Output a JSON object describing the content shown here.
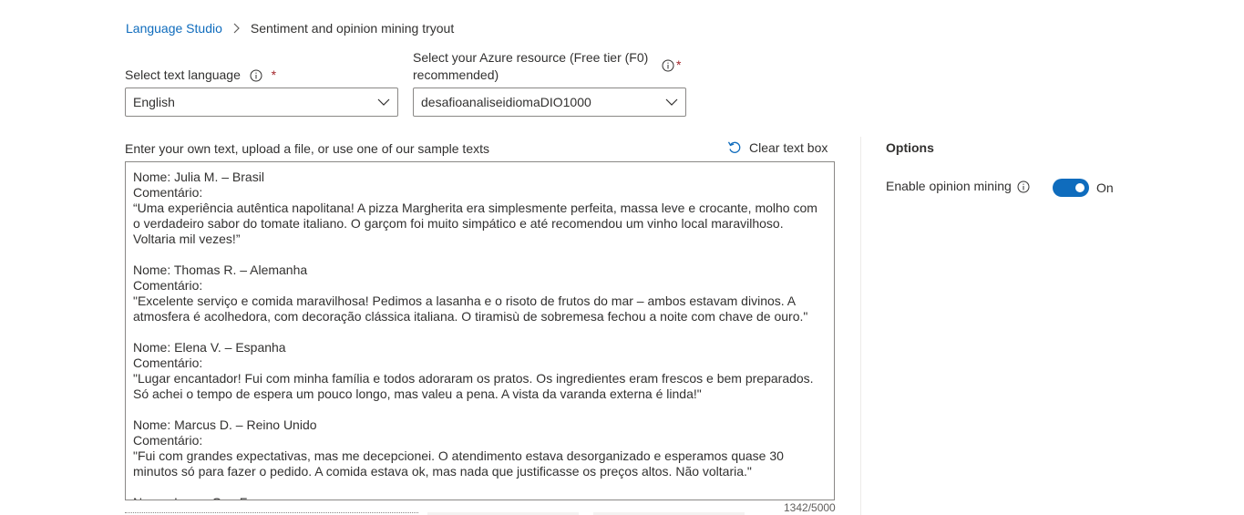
{
  "breadcrumb": {
    "home": "Language Studio",
    "current": "Sentiment and opinion mining tryout"
  },
  "language": {
    "label": "Select text language",
    "required_mark": "*",
    "value": "English"
  },
  "resource": {
    "label_line1": "Select your Azure resource (Free tier (F0)",
    "label_line2": "recommended)",
    "required_mark": "*",
    "value": "desafioanaliseidiomaDIO1000"
  },
  "input": {
    "instructions": "Enter your own text, upload a file, or use one of our sample texts",
    "clear_label": "Clear text box",
    "text": "Nome: Julia M. – Brasil\nComentário:\n“Uma experiência autêntica napolitana! A pizza Margherita era simplesmente perfeita, massa leve e crocante, molho com o verdadeiro sabor do tomate italiano. O garçom foi muito simpático e até recomendou um vinho local maravilhoso. Voltaria mil vezes!”\n\nNome: Thomas R. – Alemanha\nComentário:\n\"Excelente serviço e comida maravilhosa! Pedimos a lasanha e o risoto de frutos do mar – ambos estavam divinos. A atmosfera é acolhedora, com decoração clássica italiana. O tiramisù de sobremesa fechou a noite com chave de ouro.\"\n\nNome: Elena V. – Espanha\nComentário:\n\"Lugar encantador! Fui com minha família e todos adoraram os pratos. Os ingredientes eram frescos e bem preparados. Só achei o tempo de espera um pouco longo, mas valeu a pena. A vista da varanda externa é linda!\"\n\nNome: Marcus D. – Reino Unido\nComentário:\n\"Fui com grandes expectativas, mas me decepcionei. O atendimento estava desorganizado e esperamos quase 30 minutos só para fazer o pedido. A comida estava ok, mas nada que justificasse os preços altos. Não voltaria.\"\n\nNome: Lucas G. – Fr",
    "char_count": "1342/5000"
  },
  "options": {
    "title": "Options",
    "opinion_mining_label": "Enable opinion mining",
    "toggle_state": "On",
    "toggle_color": "#0f6cbd"
  },
  "colors": {
    "accent": "#0f6cbd",
    "required": "#a4262c"
  }
}
